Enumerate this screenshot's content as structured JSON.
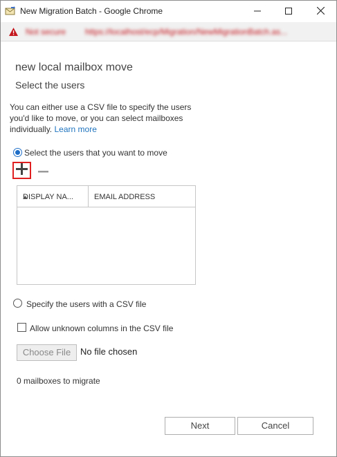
{
  "window": {
    "title": "New Migration Batch - Google Chrome",
    "icons": [
      "mail-migration-icon",
      "minimize-icon",
      "maximize-icon",
      "close-icon"
    ]
  },
  "addressbar": {
    "security_label": "Not secure",
    "url": "https://localhost/ecp/Migration/NewMigrationBatch.as..."
  },
  "page": {
    "heading": "new local mailbox move",
    "subheading": "Select the users",
    "intro": "You can either use a CSV file to specify the users you'd like to move, or you can select mailboxes individually.",
    "learn_more": "Learn more"
  },
  "options": {
    "select_users_label": "Select the users that you want to move",
    "csv_label": "Specify the users with a CSV file",
    "allow_unknown_label": "Allow unknown columns in the CSV file",
    "selected": "select_users"
  },
  "toolbar": {
    "add_icon": "plus-icon",
    "remove_icon": "minus-icon"
  },
  "table": {
    "columns": [
      "DISPLAY NA...",
      "EMAIL ADDRESS"
    ],
    "rows": []
  },
  "file": {
    "button_label": "Choose File",
    "status": "No file chosen"
  },
  "summary": {
    "count_text": "0 mailboxes to migrate"
  },
  "footer": {
    "next_label": "Next",
    "cancel_label": "Cancel"
  },
  "colors": {
    "accent": "#1e6ec8",
    "link": "#1e73be",
    "warning": "#c4171e",
    "highlight_box": "#e02020"
  }
}
